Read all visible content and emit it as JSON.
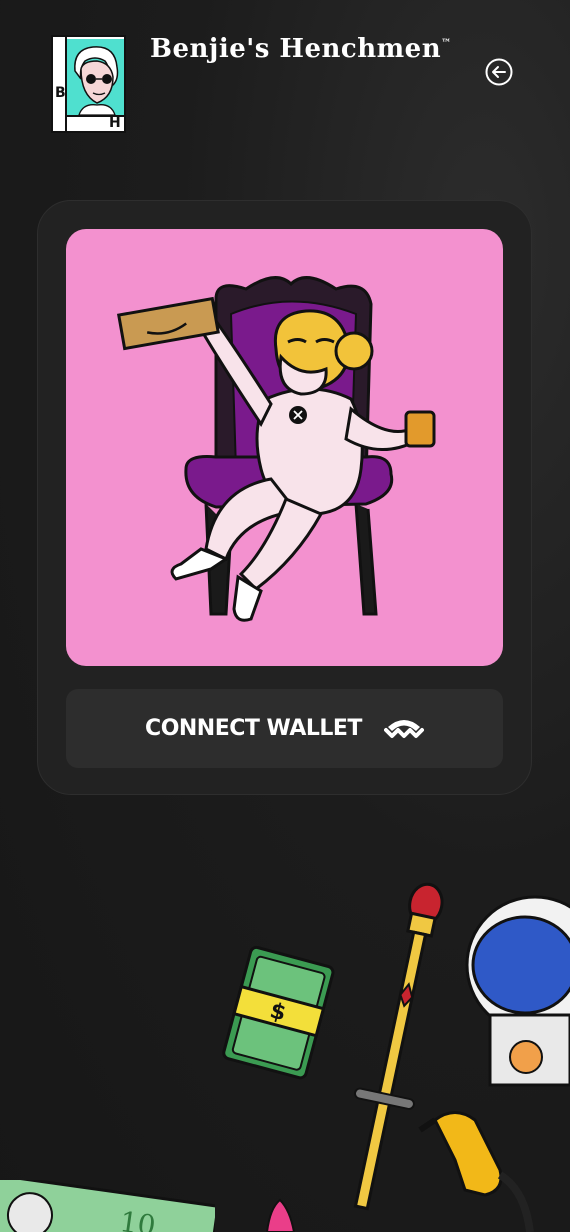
{
  "header": {
    "logo_letters": [
      "B",
      "H"
    ],
    "title": "Benjie's Henchmen",
    "title_mark": "™",
    "back_icon": "arrow-left-circle-icon"
  },
  "card": {
    "image_alt": "pink-background-ape-on-throne",
    "close_icon": "close-icon"
  },
  "connect": {
    "label": "CONNECT WALLET",
    "icon": "walletconnect-icon"
  },
  "colors": {
    "background": "#1c1c1c",
    "card": "#222222",
    "image_bg": "#f391cf",
    "button": "#2d2d2d",
    "text": "#ffffff"
  },
  "decorations": [
    "money-stack-icon",
    "scepter-icon",
    "astronaut-helmet-icon",
    "fuel-nozzle-icon",
    "dollar-bill-icon"
  ]
}
